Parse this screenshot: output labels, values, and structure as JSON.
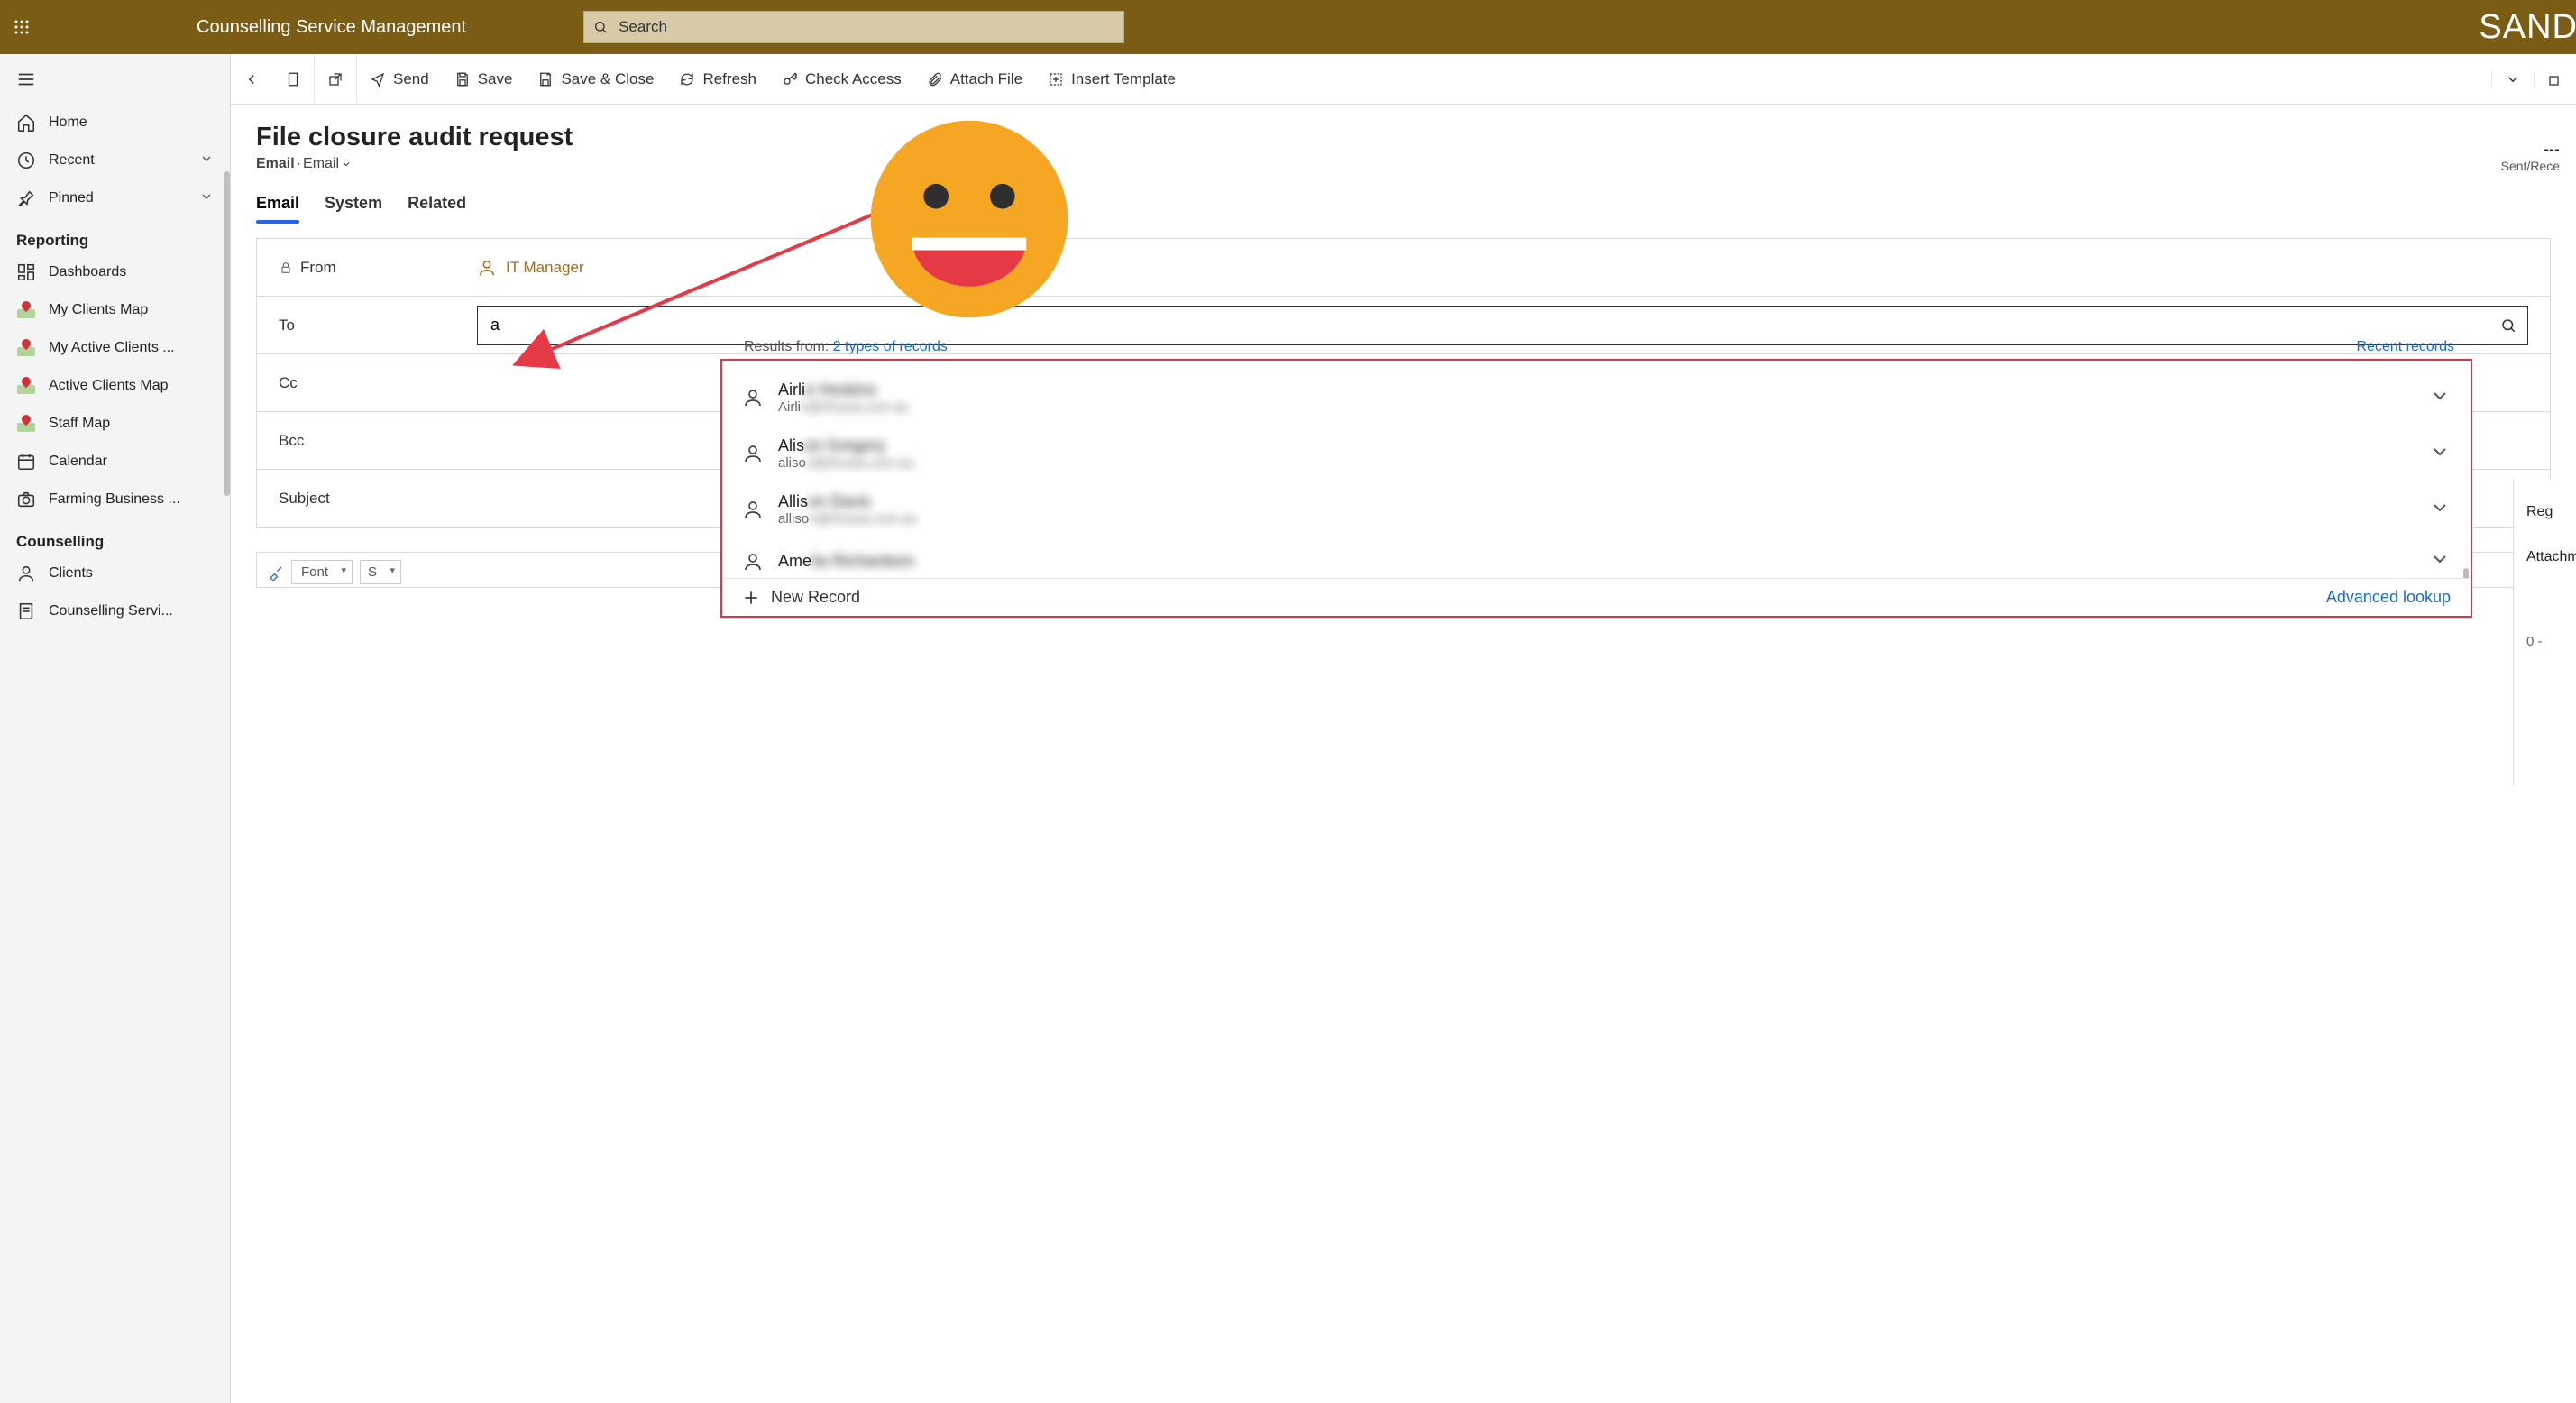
{
  "top": {
    "app_title": "Counselling Service Management",
    "search_placeholder": "Search",
    "sandbox_label": "SAND"
  },
  "sidebar": {
    "home": "Home",
    "recent": "Recent",
    "pinned": "Pinned",
    "group_reporting": "Reporting",
    "dashboards": "Dashboards",
    "my_clients_map": "My Clients Map",
    "my_active_clients": "My Active Clients ...",
    "active_clients_map": "Active Clients Map",
    "staff_map": "Staff Map",
    "calendar": "Calendar",
    "farming_business": "Farming Business ...",
    "group_counselling": "Counselling",
    "clients": "Clients",
    "counselling_servi": "Counselling Servi..."
  },
  "cmd": {
    "send": "Send",
    "save": "Save",
    "save_close": "Save & Close",
    "refresh": "Refresh",
    "check_access": "Check Access",
    "attach_file": "Attach File",
    "insert_template": "Insert Template"
  },
  "page": {
    "title": "File closure audit request",
    "sub_l": "Email",
    "sub_dot": " ·  ",
    "sub_r": "Email",
    "head_dash": "---",
    "head_lbl": "Sent/Rece"
  },
  "tabs": {
    "email": "Email",
    "system": "System",
    "related": "Related"
  },
  "form": {
    "from_label": "From",
    "from_value": "IT Manager",
    "to_label": "To",
    "to_value": "a",
    "cc_label": "Cc",
    "bcc_label": "Bcc",
    "subject_label": "Subject"
  },
  "dropdown": {
    "results_from": "Results from:",
    "types": "2 types of records",
    "recent": "Recent records",
    "items": [
      {
        "name": "Airli",
        "email": "Airli"
      },
      {
        "name": "Alis",
        "email": "aliso"
      },
      {
        "name": "Allis",
        "email": "alliso"
      },
      {
        "name": "Ame",
        "email": ""
      }
    ],
    "new_record": "New Record",
    "advanced": "Advanced lookup"
  },
  "rpanel": {
    "reg": "Reg",
    "attach": "Attachm",
    "count": "0 -"
  },
  "editor": {
    "font_label": "Font",
    "size_stub": "S"
  }
}
